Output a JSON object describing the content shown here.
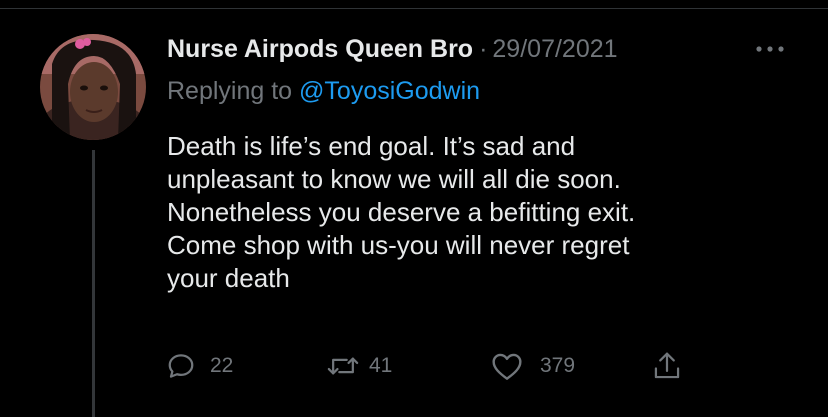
{
  "tweet": {
    "display_name": "Nurse Airpods Queen Bro",
    "separator": "·",
    "date": "29/07/2021",
    "more_icon": "more-horizontal-icon",
    "reply_prefix": "Replying to ",
    "reply_handle": "@ToyosiGodwin",
    "text_lines": [
      "Death is life’s end goal. It’s sad and",
      "unpleasant to know we will all die soon.",
      "Nonetheless you deserve a befitting exit.",
      "Come shop with us-you will never regret",
      "your death"
    ]
  },
  "actions": {
    "reply": {
      "icon": "reply-icon",
      "count": "22"
    },
    "retweet": {
      "icon": "retweet-icon",
      "count": "41"
    },
    "like": {
      "icon": "heart-icon",
      "count": "379"
    },
    "share": {
      "icon": "share-icon"
    }
  },
  "colors": {
    "background": "#000000",
    "primary_text": "#e7e9ea",
    "secondary_text": "#71767b",
    "link": "#1d9bf0",
    "thread_line": "#333639"
  }
}
